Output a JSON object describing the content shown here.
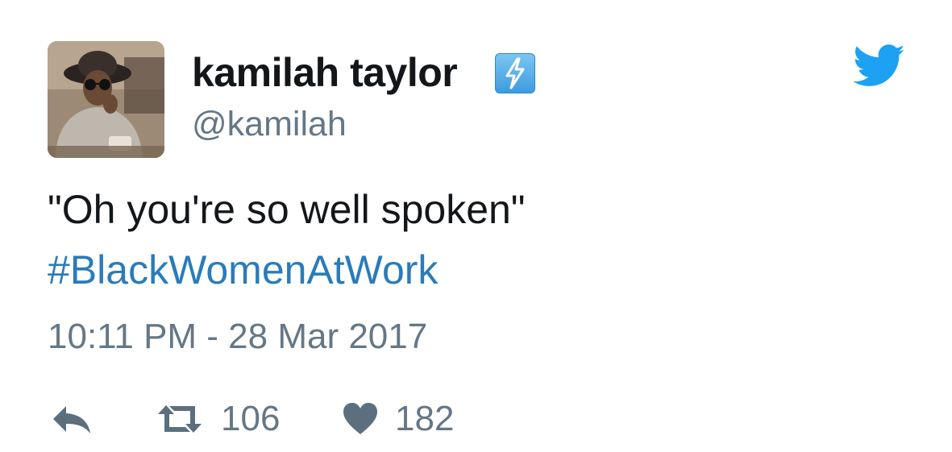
{
  "tweet": {
    "display_name": "kamilah taylor",
    "badge_icon": "lightning-emoji-icon",
    "handle": "@kamilah",
    "text": "\"Oh you're so well spoken\"",
    "hashtag": "#BlackWomenAtWork",
    "timestamp": "10:11 PM - 28 Mar 2017",
    "retweet_count": "106",
    "like_count": "182"
  },
  "icons": {
    "brand": "twitter-bird-icon",
    "reply": "reply-icon",
    "retweet": "retweet-icon",
    "like": "heart-icon"
  },
  "colors": {
    "text": "#14171a",
    "secondary": "#657786",
    "link": "#2b7bb9",
    "brand": "#1da1f2",
    "action_icon": "#5b6f7e"
  }
}
